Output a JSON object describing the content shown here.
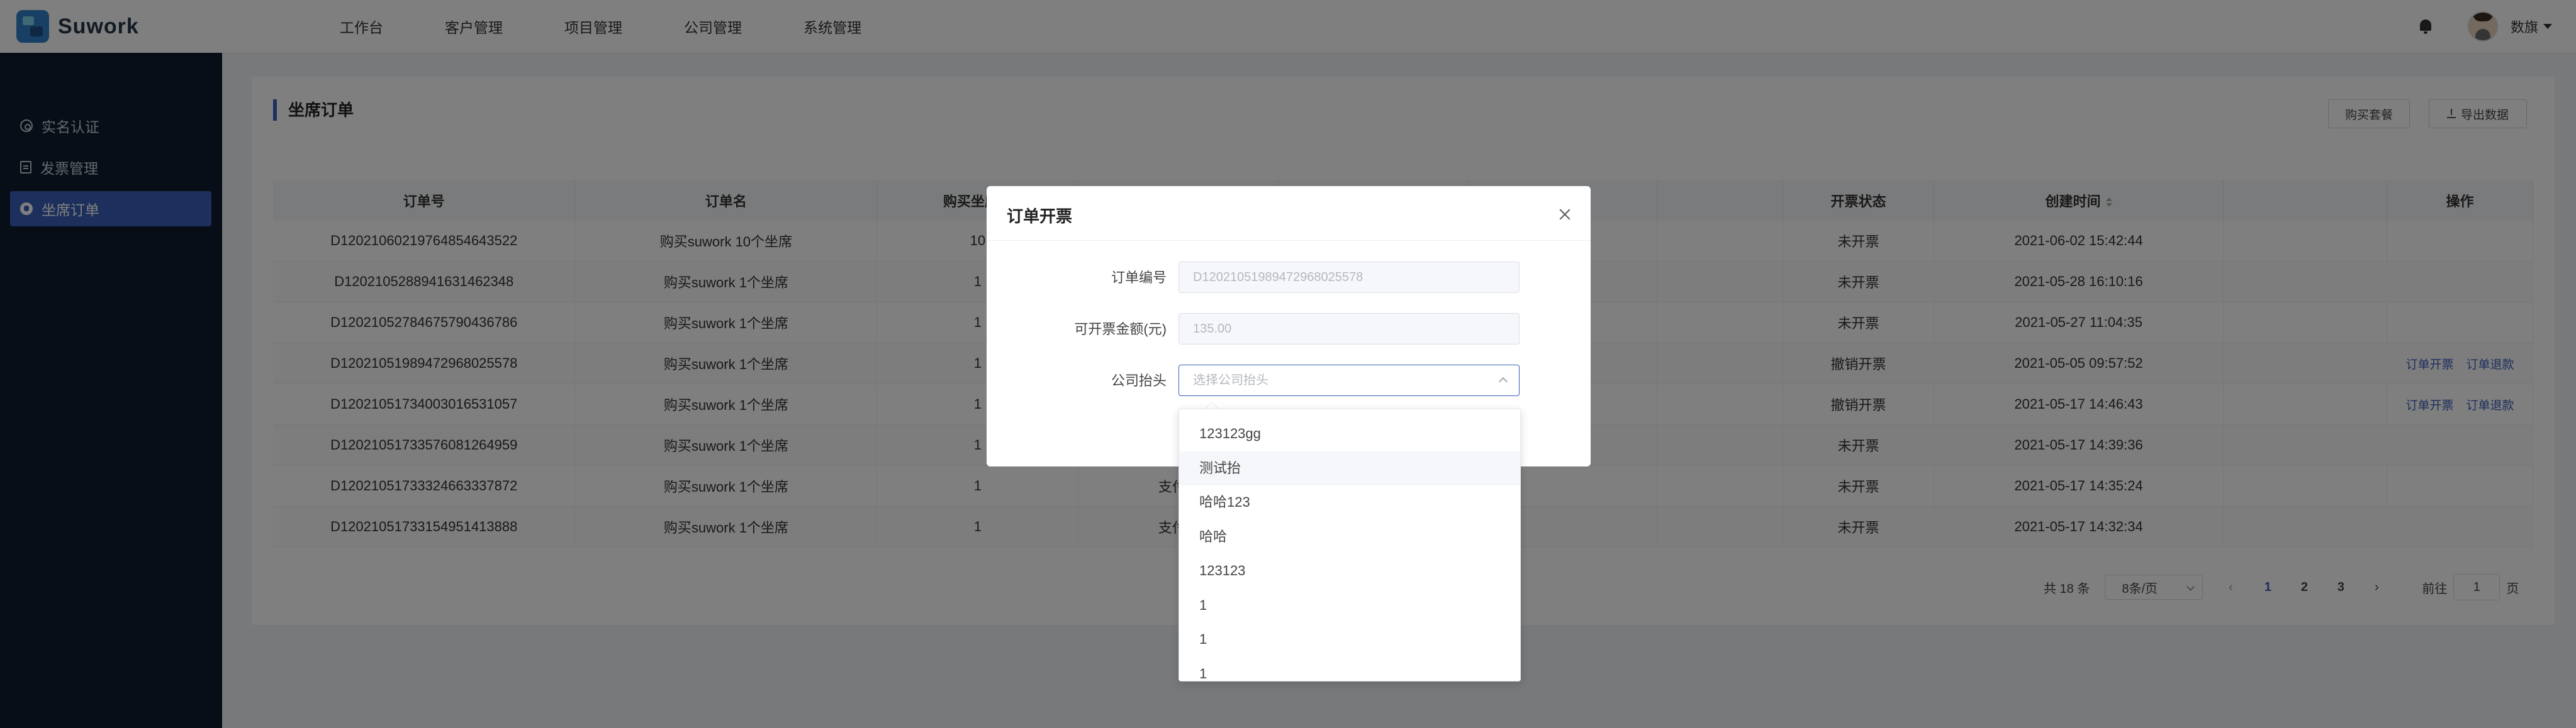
{
  "app": {
    "logo_text": "Suwork"
  },
  "topnav": {
    "items": [
      "工作台",
      "客户管理",
      "项目管理",
      "公司管理",
      "系统管理"
    ]
  },
  "user": {
    "name": "数旗"
  },
  "sidebar": {
    "items": [
      {
        "label": "实名认证",
        "icon": "badge-icon",
        "active": false
      },
      {
        "label": "发票管理",
        "icon": "invoice-icon",
        "active": false
      },
      {
        "label": "坐席订单",
        "icon": "seat-icon",
        "active": true
      }
    ]
  },
  "page": {
    "title": "坐席订单",
    "buy_button": "购买套餐",
    "export_button": "导出数据"
  },
  "table": {
    "columns": [
      "订单号",
      "订单名",
      "购买坐席数",
      "",
      "",
      "",
      "",
      "开票状态",
      "创建时间",
      "",
      "操作"
    ],
    "rows": [
      {
        "order_no": "D1202106021976485464352​2",
        "name": "购买suwork 10个坐席",
        "seats": "10",
        "pay": "",
        "status": "未开票",
        "created": "2021-06-02 15:42:44",
        "ops": []
      },
      {
        "order_no": "D120210528894163146234​8",
        "name": "购买suwork 1个坐席",
        "seats": "1",
        "pay": "",
        "status": "未开票",
        "created": "2021-05-28 16:10:16",
        "ops": []
      },
      {
        "order_no": "D120210527846757904367​86",
        "name": "购买suwork 1个坐席",
        "seats": "1",
        "pay": "",
        "status": "未开票",
        "created": "2021-05-27 11:04:35",
        "ops": []
      },
      {
        "order_no": "D1202105198947296802557​8",
        "name": "购买suwork 1个坐席",
        "seats": "1",
        "pay": "",
        "status": "撤销开票",
        "created": "2021-05-05 09:57:52",
        "ops": [
          "订单开票",
          "订单退款"
        ]
      },
      {
        "order_no": "D1202105173400301653105​7",
        "name": "购买suwork 1个坐席",
        "seats": "1",
        "pay": "",
        "status": "撤销开票",
        "created": "2021-05-17 14:46:43",
        "ops": [
          "订单开票",
          "订单退款"
        ]
      },
      {
        "order_no": "D1202105173357608126495​9",
        "name": "购买suwork 1个坐席",
        "seats": "1",
        "pay": "",
        "status": "未开票",
        "created": "2021-05-17 14:39:36",
        "ops": []
      },
      {
        "order_no": "D1202105173332466333787​2",
        "name": "购买suwork 1个坐席",
        "seats": "1",
        "pay": "支付宝",
        "status": "未开票",
        "created": "2021-05-17 14:35:24",
        "ops": []
      },
      {
        "order_no": "D1202105173315495141388​8",
        "name": "购买suwork 1个坐席",
        "seats": "1",
        "pay": "支付宝",
        "status": "未开票",
        "created": "2021-05-17 14:32:34",
        "ops": []
      }
    ]
  },
  "pagination": {
    "total": "共 18 条",
    "page_size": "8条/页",
    "pages": [
      "1",
      "2",
      "3"
    ],
    "current": "1",
    "goto_label": "前往",
    "goto_value": "1",
    "goto_suffix": "页"
  },
  "modal": {
    "title": "订单开票",
    "fields": {
      "order_no_label": "订单编号",
      "order_no_value": "D1202105198947296802557​8",
      "amount_label": "可开票金额(元)",
      "amount_value": "135.00",
      "company_label": "公司抬头",
      "company_placeholder": "选择公司抬头"
    }
  },
  "dropdown": {
    "options": [
      "123123gg",
      "测试抬",
      "哈哈123",
      "哈哈",
      "123123",
      "1",
      "1",
      "1"
    ],
    "hover_index": 1
  }
}
